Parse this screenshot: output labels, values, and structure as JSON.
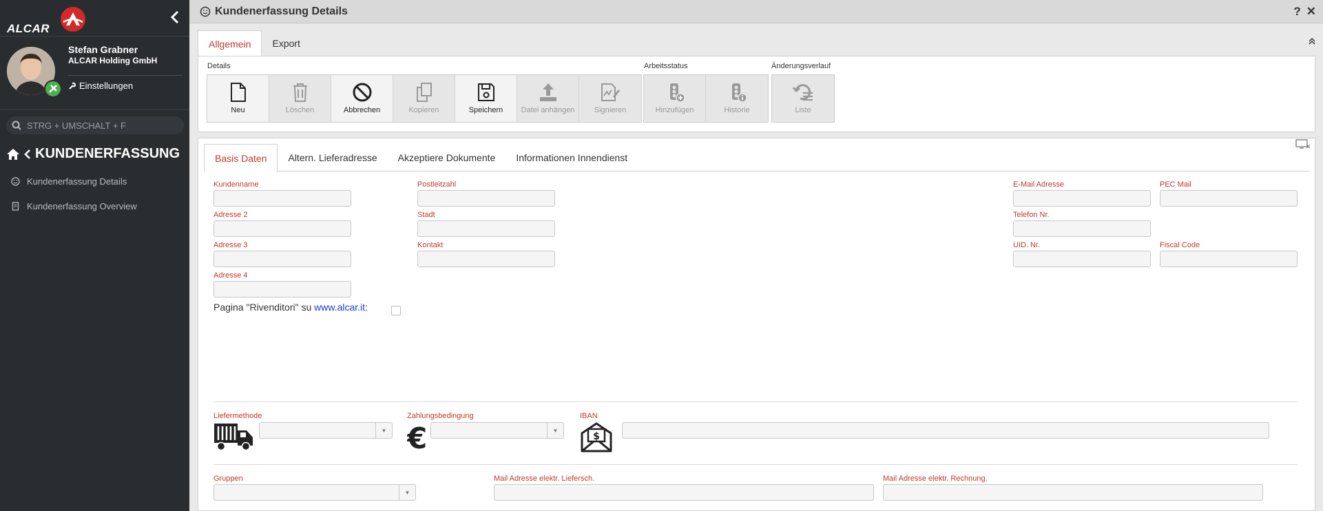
{
  "sidebar": {
    "logo_text": "ALCAR",
    "user": {
      "name": "Stefan Grabner",
      "company": "ALCAR Holding GmbH",
      "settings_label": "Einstellungen"
    },
    "search": {
      "placeholder": "STRG + UMSCHALT + F"
    },
    "section_title": "KUNDENERFASSUNG",
    "nav_items": [
      {
        "label": "Kundenerfassung Details",
        "icon": "smiley-icon"
      },
      {
        "label": "Kundenerfassung Overview",
        "icon": "document-icon"
      }
    ]
  },
  "header": {
    "title": "Kundenerfassung Details",
    "help": "?",
    "close": "✕"
  },
  "top_tabs": [
    "Allgemein",
    "Export"
  ],
  "toolbar": {
    "groups": {
      "details": "Details",
      "arbeitsstatus": "Arbeitsstatus",
      "aenderungsverlauf": "Änderungsverlauf"
    },
    "buttons": {
      "neu": "Neu",
      "loeschen": "Löschen",
      "abbrechen": "Abbrechen",
      "kopieren": "Kopieren",
      "speichern": "Speichern",
      "datei_anhaengen": "Datei anhängen",
      "signieren": "Signieren",
      "hinzufuegen": "Hinzufügen",
      "historie": "Historie",
      "liste": "Liste"
    }
  },
  "sub_tabs": [
    "Basis Daten",
    "Altern. Lieferadresse",
    "Akzeptiere Dokumente",
    "Informationen Innendienst"
  ],
  "form": {
    "kundenname": {
      "label": "Kundenname",
      "value": ""
    },
    "adresse2": {
      "label": "Adresse 2",
      "value": ""
    },
    "adresse3": {
      "label": "Adresse 3",
      "value": ""
    },
    "adresse4": {
      "label": "Adresse 4",
      "value": ""
    },
    "postleitzahl": {
      "label": "Postleitzahl",
      "value": ""
    },
    "stadt": {
      "label": "Stadt",
      "value": ""
    },
    "kontakt": {
      "label": "Kontakt",
      "value": ""
    },
    "email": {
      "label": "E-Mail Adresse",
      "value": ""
    },
    "pec": {
      "label": "PEC Mail",
      "value": ""
    },
    "telefon": {
      "label": "Telefon Nr.",
      "value": ""
    },
    "uid": {
      "label": "UID. Nr.",
      "value": ""
    },
    "fiscal": {
      "label": "Fiscal Code",
      "value": ""
    },
    "rivenditori_text": "Pagina \"Rivenditori\" su ",
    "rivenditori_link": "www.alcar.it:",
    "liefermethode": {
      "label": "Liefermethode",
      "value": ""
    },
    "zahlungsbedingung": {
      "label": "Zahlungsbedingung",
      "value": ""
    },
    "iban": {
      "label": "IBAN",
      "value": ""
    },
    "gruppen": {
      "label": "Gruppen",
      "value": ""
    },
    "mail_liefersch": {
      "label": "Mail Adresse elektr. Liefersch.",
      "value": ""
    },
    "mail_rechnung": {
      "label": "Mail Adresse elektr. Rechnung.",
      "value": ""
    }
  },
  "colors": {
    "accent": "#c0392b",
    "sidebar_bg": "#2a2d30",
    "link": "#1a3ad3"
  }
}
